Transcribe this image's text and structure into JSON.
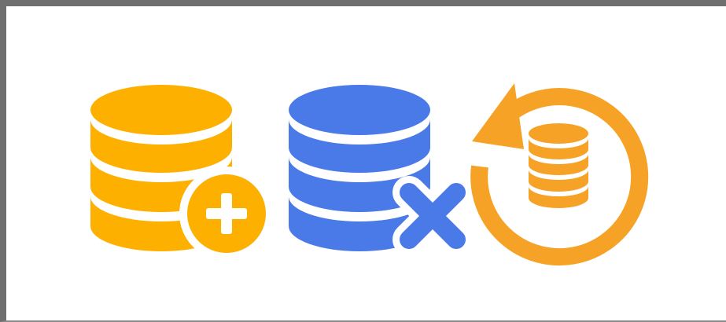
{
  "icons": [
    {
      "name": "database-add-icon",
      "color": "#FDB000",
      "badge": "plus"
    },
    {
      "name": "database-delete-icon",
      "color": "#4A79E8",
      "badge": "x"
    },
    {
      "name": "database-restore-icon",
      "color": "#F6A226",
      "badge": "restore-arrow"
    }
  ],
  "colors": {
    "background": "#ffffff",
    "frame": "#6f6f6f",
    "gap": "#ffffff"
  }
}
